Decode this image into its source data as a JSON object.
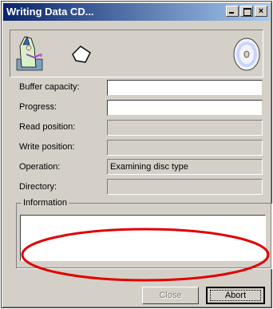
{
  "window": {
    "title": "Writing Data CD..."
  },
  "fields": [
    {
      "label": "Buffer capacity:",
      "value": "",
      "style": "white"
    },
    {
      "label": "Progress:",
      "value": "",
      "style": "white"
    },
    {
      "label": "Read position:",
      "value": "",
      "style": "disabled"
    },
    {
      "label": "Write position:",
      "value": "",
      "style": "disabled"
    },
    {
      "label": "Operation:",
      "value": "Examining disc type",
      "style": "plain"
    },
    {
      "label": "Directory:",
      "value": "",
      "style": "disabled"
    }
  ],
  "information": {
    "title": "Information",
    "text": ""
  },
  "buttons": {
    "close": "Close",
    "abort": "Abort"
  },
  "icons": {
    "left": "wizard-icon",
    "middle": "data-packet-icon",
    "right": "cd-disc-icon"
  },
  "annotation": {
    "color": "#e00000"
  }
}
